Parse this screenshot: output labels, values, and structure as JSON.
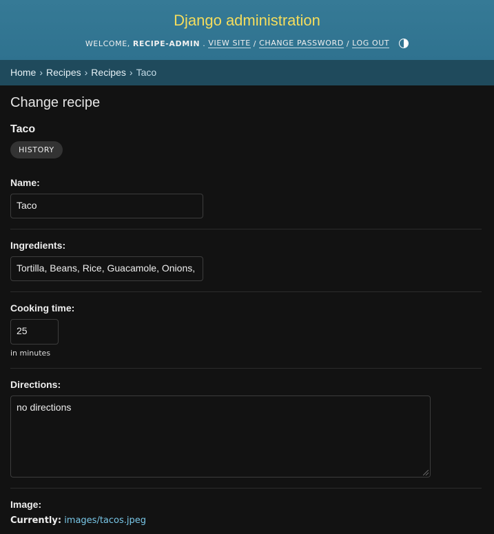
{
  "header": {
    "site_name": "Django administration",
    "welcome": "WELCOME,",
    "username": "RECIPE-ADMIN",
    "view_site": "VIEW SITE",
    "change_password": "CHANGE PASSWORD",
    "log_out": "LOG OUT",
    "separator": "/"
  },
  "breadcrumbs": {
    "items": [
      "Home",
      "Recipes",
      "Recipes",
      "Taco"
    ],
    "separator": "›"
  },
  "page": {
    "title": "Change recipe",
    "object_title": "Taco",
    "history_button": "HISTORY"
  },
  "form": {
    "name": {
      "label": "Name:",
      "value": "Taco"
    },
    "ingredients": {
      "label": "Ingredients:",
      "value": "Tortilla, Beans, Rice, Guacamole, Onions,"
    },
    "cooking_time": {
      "label": "Cooking time:",
      "value": "25",
      "help": "in minutes"
    },
    "directions": {
      "label": "Directions:",
      "value": "no directions"
    },
    "image": {
      "label": "Image:",
      "currently_label": "Currently:",
      "current_value": "images/tacos.jpeg"
    }
  },
  "colors": {
    "header_bg": "#367a96",
    "site_name": "#f5dd5d",
    "breadcrumb_bg": "#1f4a5c",
    "page_bg": "#121212",
    "link": "#79c7e8"
  }
}
